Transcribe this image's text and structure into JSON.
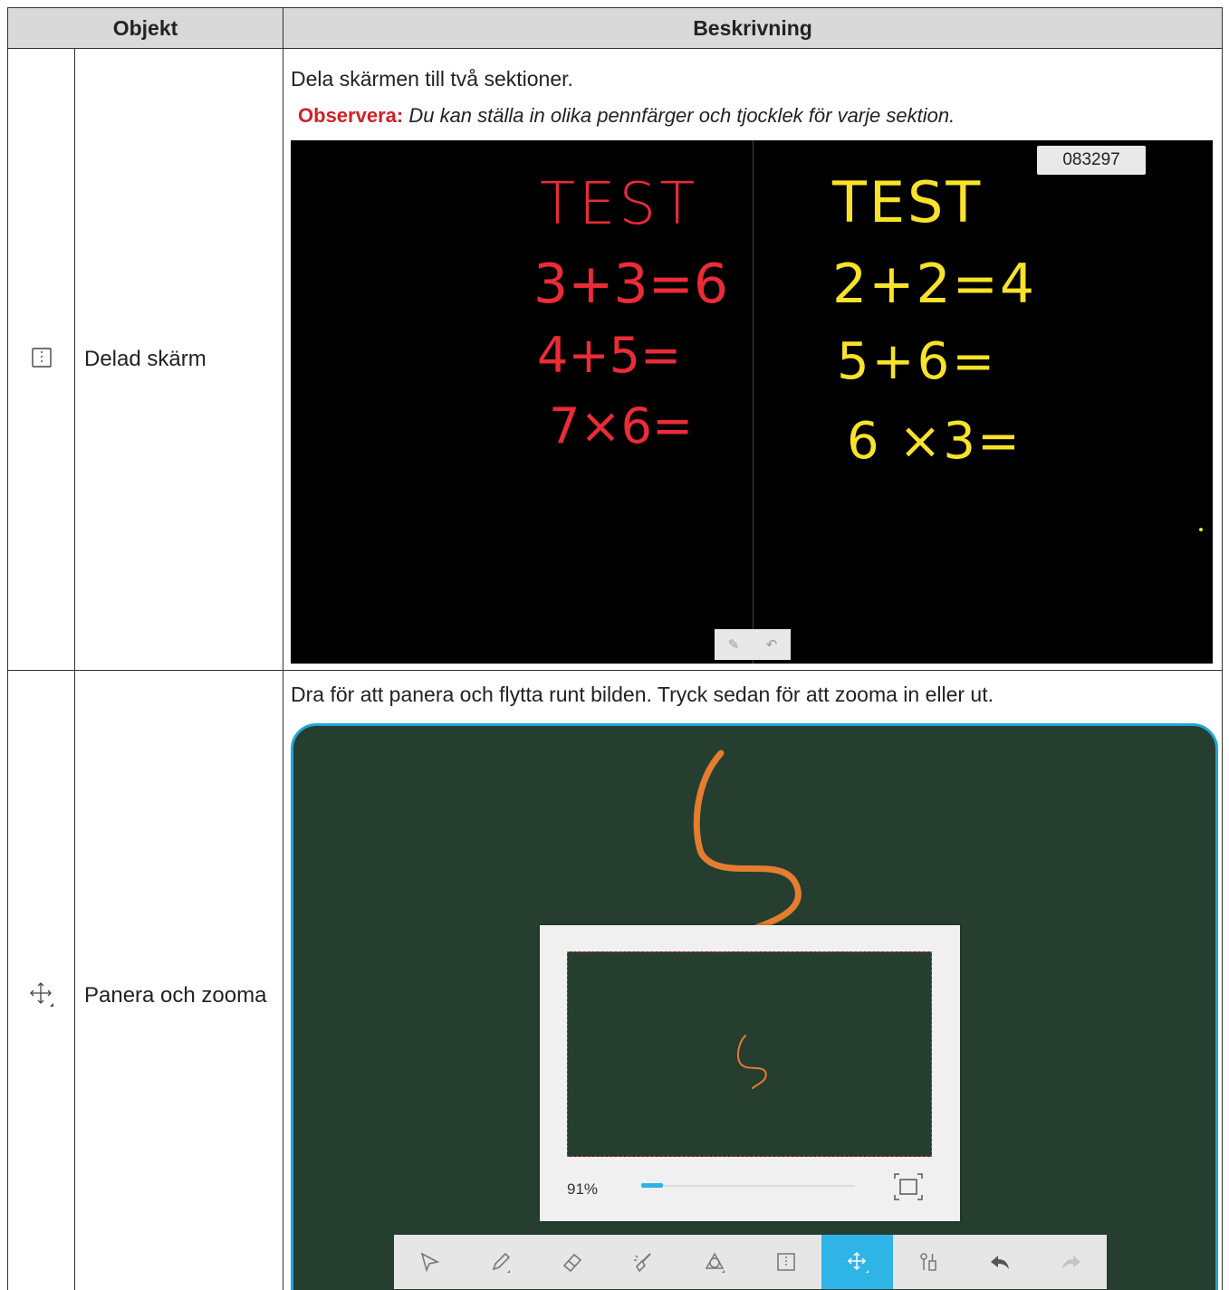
{
  "header": {
    "col_object": "Objekt",
    "col_description": "Beskrivning"
  },
  "rows": [
    {
      "icon": "split-screen-icon",
      "name": "Delad skärm",
      "description": "Dela skärmen till två sektioner.",
      "note_label": "Observera:",
      "note_text": "Du kan ställa in olika pennfärger och tjocklek för varje sektion.",
      "screenshot": {
        "session_code": "083297",
        "left_lines": [
          "TEST",
          "3+3=6",
          "4+5=",
          "7×6="
        ],
        "right_lines": [
          "TEST",
          "2+2=4",
          "5+6=",
          "6 ×3="
        ],
        "left_color": "#ec2b36",
        "right_color": "#f8e32a"
      }
    },
    {
      "icon": "pan-zoom-icon",
      "name": "Panera och zooma",
      "description": "Dra för att panera och flytta runt bilden. Tryck sedan för att zooma in eller ut.",
      "screenshot": {
        "zoom_percent": "91%",
        "zoom_level": 0.91,
        "toolbar": [
          "select-icon",
          "pen-icon",
          "eraser-icon",
          "clear-icon",
          "shape-icon",
          "split-screen-icon",
          "pan-zoom-icon",
          "tools-icon",
          "undo-icon",
          "redo-icon"
        ],
        "active_tool": "pan-zoom-icon",
        "board_color": "#253e30",
        "stroke_color": "#e47d2d",
        "frame_color": "#1fa6d8"
      }
    }
  ]
}
